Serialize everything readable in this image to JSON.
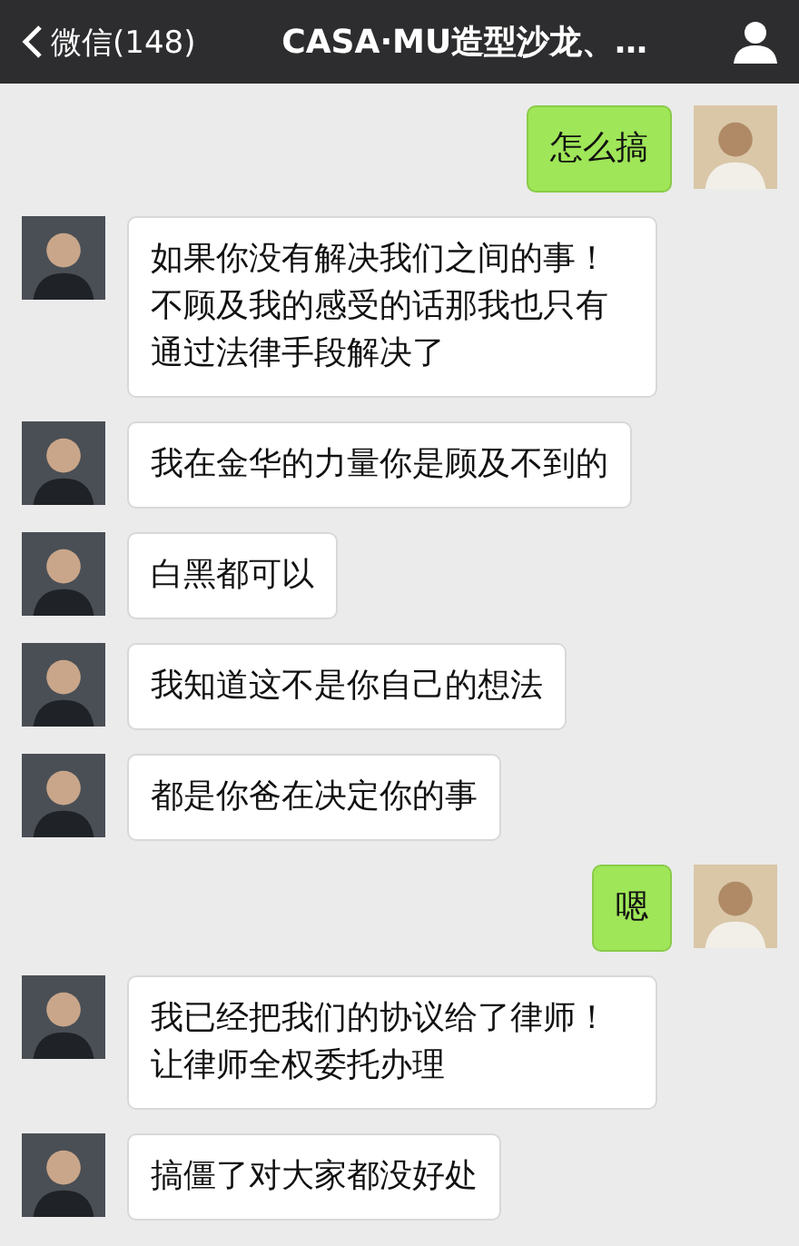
{
  "header": {
    "back": "微信(148)",
    "title": "CASA·MU造型沙龙、…"
  },
  "messages": [
    {
      "outgoing": true,
      "text": "怎么搞"
    },
    {
      "outgoing": false,
      "text": "如果你没有解决我们之间的事！不顾及我的感受的话那我也只有通过法律手段解决了"
    },
    {
      "outgoing": false,
      "text": "我在金华的力量你是顾及不到的"
    },
    {
      "outgoing": false,
      "text": "白黑都可以"
    },
    {
      "outgoing": false,
      "text": "我知道这不是你自己的想法"
    },
    {
      "outgoing": false,
      "text": "都是你爸在决定你的事"
    },
    {
      "outgoing": true,
      "text": "嗯"
    },
    {
      "outgoing": false,
      "text": "我已经把我们的协议给了律师！让律师全权委托办理"
    },
    {
      "outgoing": false,
      "text": "搞僵了对大家都没好处"
    }
  ]
}
